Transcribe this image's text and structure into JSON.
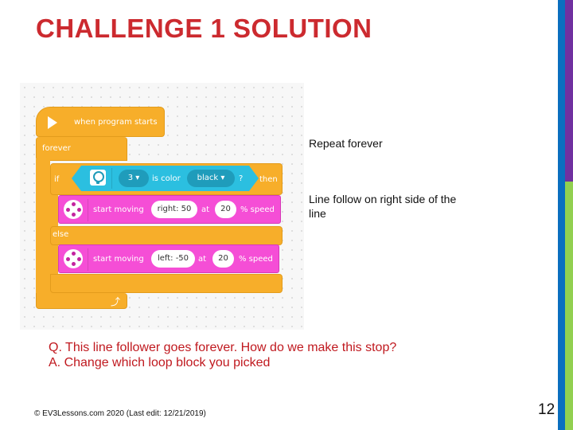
{
  "slide": {
    "title": "CHALLENGE 1 SOLUTION",
    "page_number": "12",
    "footer": "© EV3Lessons.com 2020 (Last edit: 12/21/2019)",
    "accent_colors": {
      "title_red": "#cc2a2f",
      "bar_blue": "#0a6fbf",
      "bar_purple": "#7030a0",
      "bar_green": "#92d050"
    }
  },
  "program": {
    "hat_label": "when program starts",
    "hat_icon": "play-icon",
    "forever_label": "forever",
    "loop_icon": "loop-arrow-icon",
    "if_label": "if",
    "then_label": "then",
    "else_label": "else",
    "condition": {
      "sensor_icon": "color-sensor-icon",
      "port": "3",
      "is_color_label": "is color",
      "color": "black",
      "question": "?"
    },
    "then_block": {
      "icon": "motor-icon",
      "label": "start moving",
      "steering": "right: 50",
      "at_label": "at",
      "speed": "20",
      "speed_label": "% speed"
    },
    "else_block": {
      "icon": "motor-icon",
      "label": "start moving",
      "steering": "left: -50",
      "at_label": "at",
      "speed": "20",
      "speed_label": "% speed"
    }
  },
  "notes": {
    "repeat": "Repeat forever",
    "line_follow_1": "Line follow on right side of the",
    "line_follow_2": "line"
  },
  "qa": {
    "question": "Q. This line follower goes forever. How do we make this stop?",
    "answer": "A. Change which loop block you picked"
  }
}
